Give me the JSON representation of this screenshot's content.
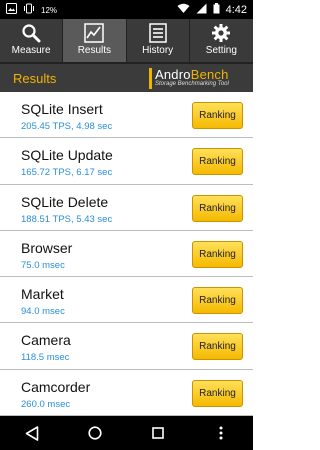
{
  "status_bar": {
    "time": "4:42",
    "left_label": "12%"
  },
  "tabs": [
    {
      "label": "Measure",
      "icon": "search-icon"
    },
    {
      "label": "Results",
      "icon": "chart-icon",
      "active": true
    },
    {
      "label": "History",
      "icon": "list-icon"
    },
    {
      "label": "Setting",
      "icon": "gear-icon"
    }
  ],
  "header": {
    "title": "Results",
    "brand_andro": "Andro",
    "brand_bench": "Bench",
    "brand_sub": "Storage Benchmarking Tool"
  },
  "results": [
    {
      "name": "SQLite Insert",
      "value": "205.45 TPS, 4.98 sec",
      "button": "Ranking"
    },
    {
      "name": "SQLite Update",
      "value": "165.72 TPS, 6.17 sec",
      "button": "Ranking"
    },
    {
      "name": "SQLite Delete",
      "value": "188.51 TPS, 5.43 sec",
      "button": "Ranking"
    },
    {
      "name": "Browser",
      "value": "75.0 msec",
      "button": "Ranking"
    },
    {
      "name": "Market",
      "value": "94.0 msec",
      "button": "Ranking"
    },
    {
      "name": "Camera",
      "value": "118.5 msec",
      "button": "Ranking"
    },
    {
      "name": "Camcorder",
      "value": "260.0 msec",
      "button": "Ranking"
    }
  ],
  "colors": {
    "accent": "#f2b400",
    "value_text": "#2a8fd6",
    "tabbar_bg": "#3a3a3a",
    "tab_active_bg": "#5a5a5a"
  }
}
